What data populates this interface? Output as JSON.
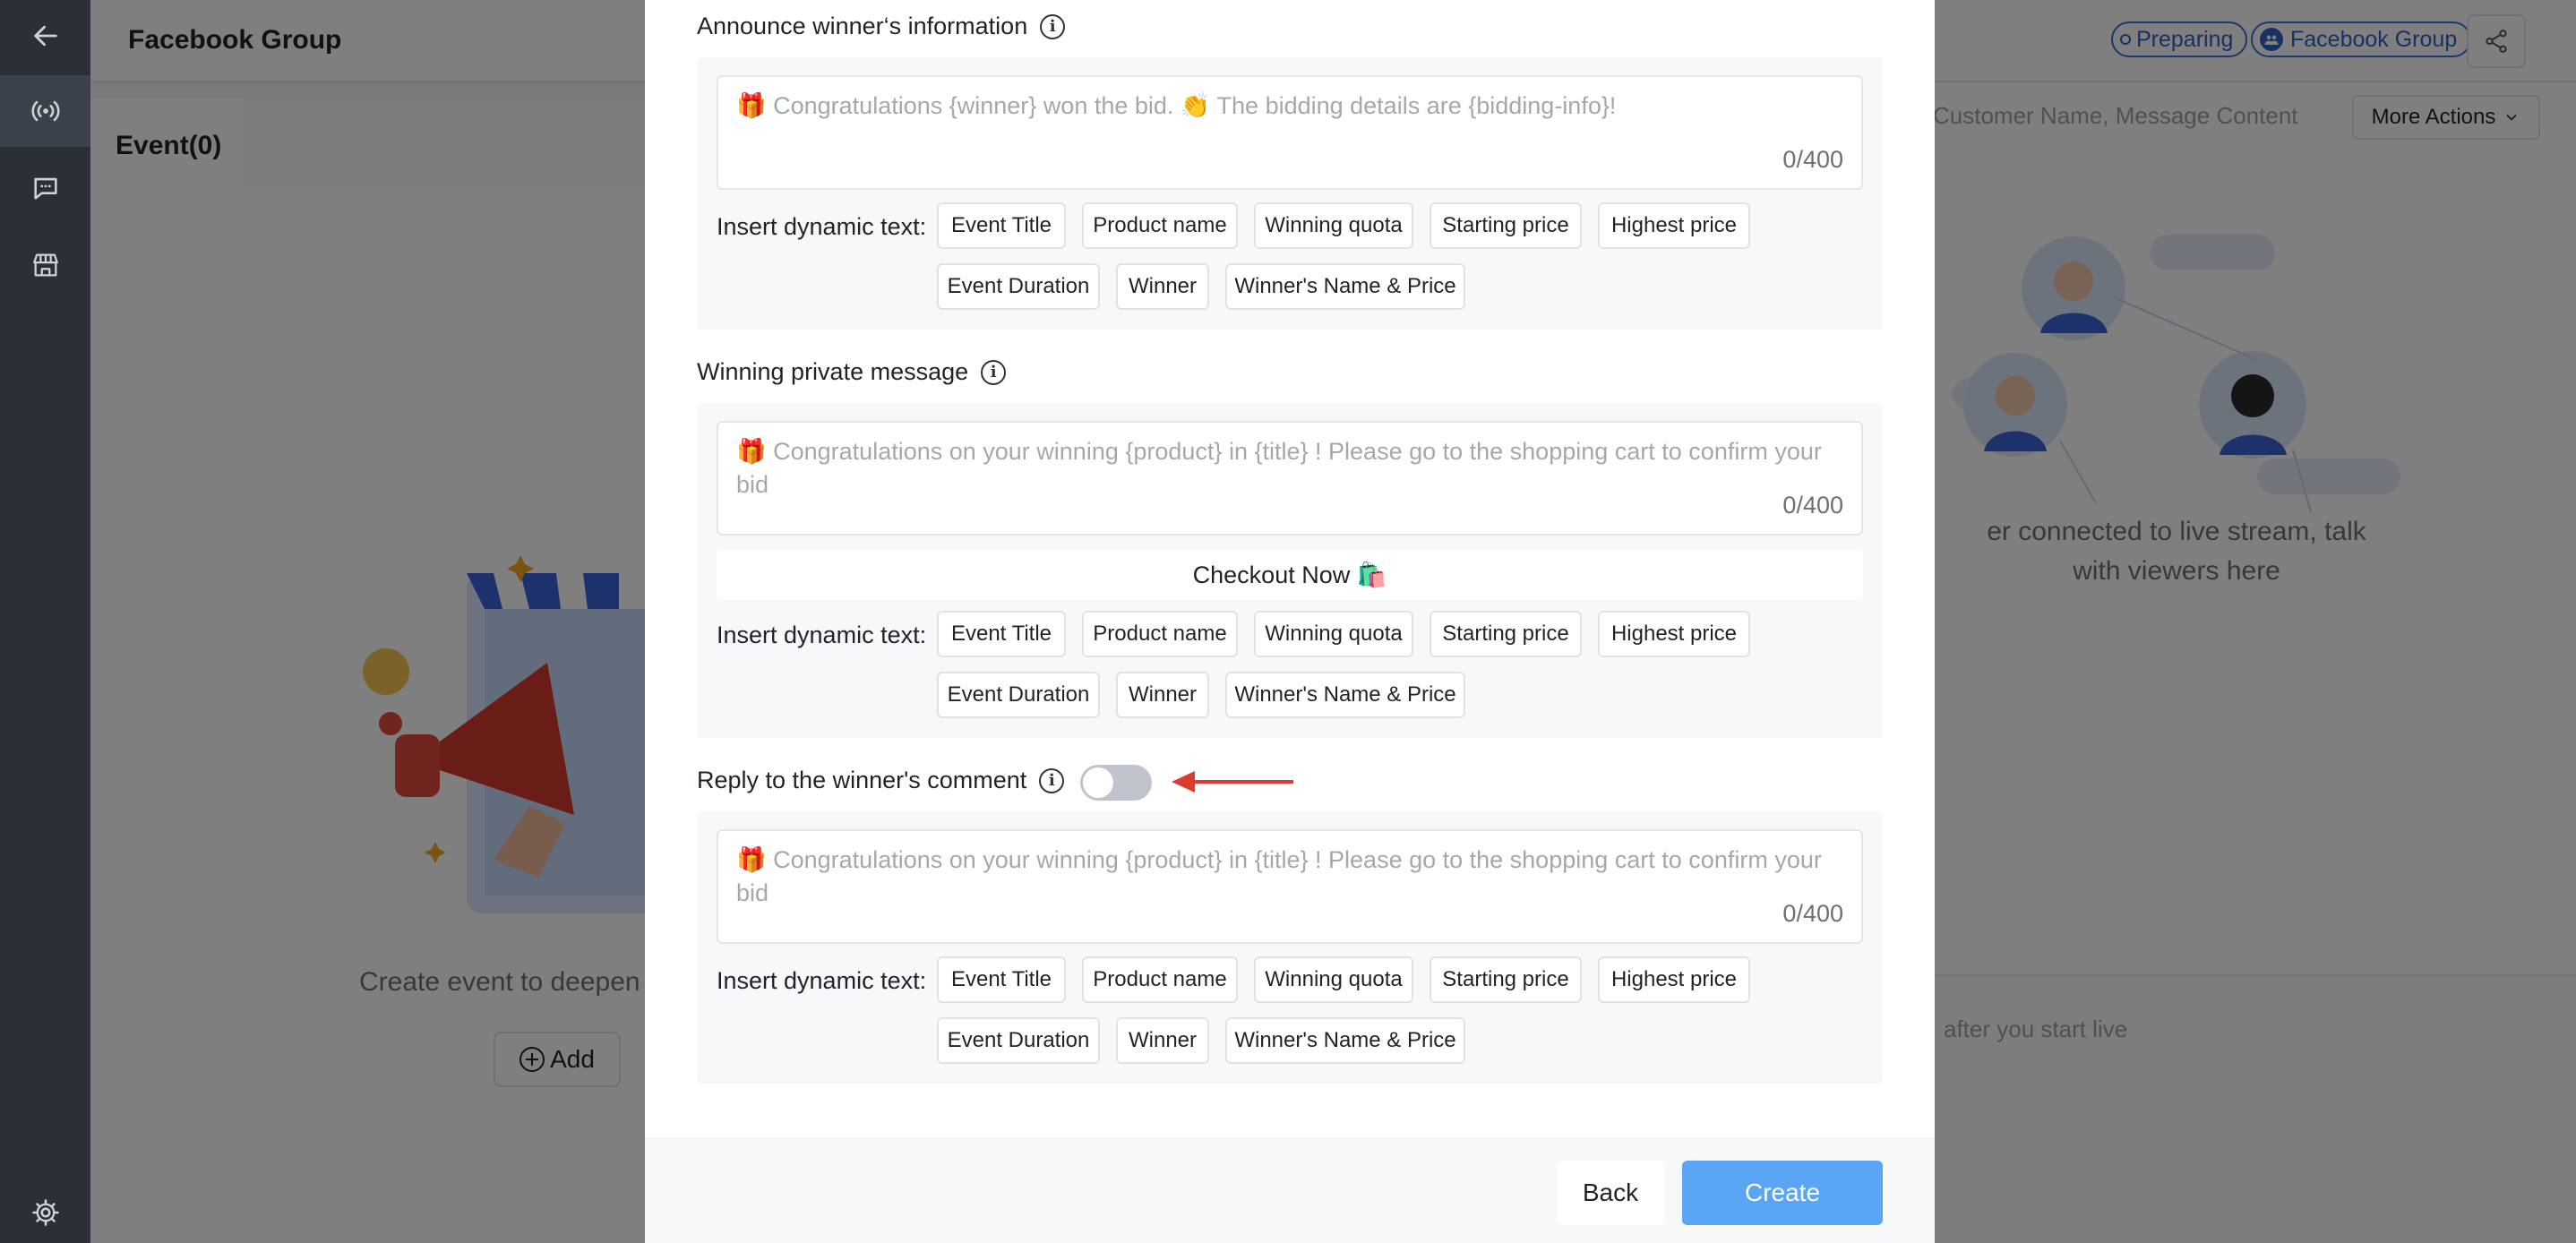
{
  "app": {
    "title": "Facebook Group",
    "status_chip": "Preparing",
    "source_chip": "Facebook Group"
  },
  "events_panel": {
    "tab_label": "Event(0)",
    "empty_text": "Create event to deepen interact",
    "add_label": "Add"
  },
  "chat_panel": {
    "search_placeholder": "Customer Name, Message Content",
    "more_actions_label": "More Actions",
    "empty_line1": "er connected to live stream, talk",
    "empty_line2": "with viewers here",
    "input_placeholder": "after you start live"
  },
  "modal": {
    "dynamic_label": "Insert dynamic text:",
    "tags": [
      "Event Title",
      "Product name",
      "Winning quota",
      "Starting price",
      "Highest price",
      "Event Duration",
      "Winner",
      "Winner's Name & Price"
    ],
    "announce": {
      "title": "Announce winner‘s information",
      "placeholder": "🎁 Congratulations {winner} won the bid. 👏 The bidding details are {bidding-info}!",
      "count": "0/400"
    },
    "private_message": {
      "title": "Winning private message",
      "placeholder": "🎁 Congratulations on your winning {product} in {title} ! Please go to the shopping cart to confirm your bid",
      "count": "0/400",
      "checkout_label": "Checkout Now 🛍️"
    },
    "reply_comment": {
      "title": "Reply to the winner's comment",
      "toggle_on": false,
      "placeholder": "🎁 Congratulations on your winning {product} in {title} ! Please go to the shopping cart to confirm your bid",
      "count": "0/400"
    },
    "back_label": "Back",
    "create_label": "Create"
  },
  "colors": {
    "sidebar": "#2b3038",
    "accent": "#5aa6f5",
    "chip_blue": "#2f62c8",
    "arrow_red": "#e03a2f"
  },
  "icons": [
    "back-arrow-icon",
    "live-broadcast-icon",
    "chat-bubble-icon",
    "store-icon",
    "settings-gear-icon",
    "share-icon",
    "info-icon",
    "chevron-down-icon"
  ]
}
